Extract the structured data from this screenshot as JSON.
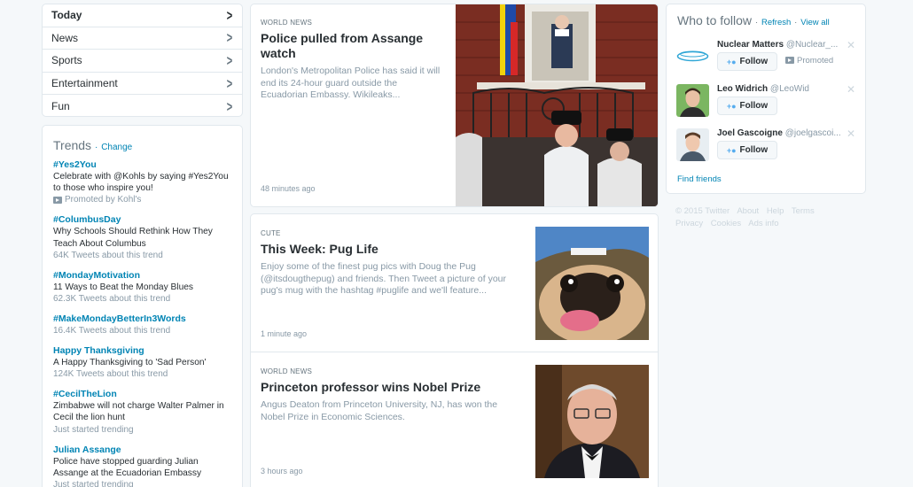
{
  "nav": {
    "items": [
      {
        "label": "Today",
        "active": true
      },
      {
        "label": "News"
      },
      {
        "label": "Sports"
      },
      {
        "label": "Entertainment"
      },
      {
        "label": "Fun"
      }
    ]
  },
  "trends": {
    "title": "Trends",
    "sep": "·",
    "change": "Change",
    "items": [
      {
        "name": "#Yes2You",
        "desc": "Celebrate with @Kohls by saying #Yes2You to those who inspire you!",
        "meta": "Promoted by Kohl's"
      },
      {
        "name": "#ColumbusDay",
        "desc": "Why Schools Should Rethink How They Teach About Columbus",
        "meta": "64K Tweets about this trend"
      },
      {
        "name": "#MondayMotivation",
        "desc": "11 Ways to Beat the Monday Blues",
        "meta": "62.3K Tweets about this trend"
      },
      {
        "name": "#MakeMondayBetterIn3Words",
        "desc": "",
        "meta": "16.4K Tweets about this trend"
      },
      {
        "name": "Happy Thanksgiving",
        "desc": "A Happy Thanksgiving to 'Sad Person'",
        "meta": "124K Tweets about this trend"
      },
      {
        "name": "#CecilTheLion",
        "desc": "Zimbabwe will not charge Walter Palmer in Cecil the lion hunt",
        "meta": "Just started trending"
      },
      {
        "name": "Julian Assange",
        "desc": "Police have stopped guarding Julian Assange at the Ecuadorian Embassy",
        "meta": "Just started trending"
      }
    ]
  },
  "stories": [
    {
      "category": "WORLD NEWS",
      "title": "Police pulled from Assange watch",
      "desc": "London's Metropolitan Police has said it will end its 24-hour guard outside the Ecuadorian Embassy. Wikileaks...",
      "time": "48 minutes ago"
    },
    {
      "category": "CUTE",
      "title": "This Week: Pug Life",
      "desc": "Enjoy some of the finest pug pics with Doug the Pug (@itsdougthepug) and friends. Then Tweet a picture of your pug's mug with the hashtag #puglife and we'll feature...",
      "time": "1 minute ago"
    },
    {
      "category": "WORLD NEWS",
      "title": "Princeton professor wins Nobel Prize",
      "desc": "Angus Deaton from Princeton University, NJ, has won the Nobel Prize in Economic Sciences.",
      "time": "3 hours ago"
    }
  ],
  "who_to_follow": {
    "title": "Who to follow",
    "sep": "·",
    "refresh": "Refresh",
    "view_all": "View all",
    "follow_label": "Follow",
    "promoted_label": "Promoted",
    "find_friends": "Find friends",
    "users": [
      {
        "name": "Nuclear Matters",
        "handle": "@Nuclear_..."
      },
      {
        "name": "Leo Widrich",
        "handle": "@LeoWid"
      },
      {
        "name": "Joel Gascoigne",
        "handle": "@joelgascoi..."
      }
    ]
  },
  "footer": {
    "links": [
      "© 2015 Twitter",
      "About",
      "Help",
      "Terms",
      "Privacy",
      "Cookies",
      "Ads info"
    ]
  },
  "colors": {
    "link": "#0084b4",
    "muted": "#8899a6",
    "border": "#e1e8ed"
  }
}
